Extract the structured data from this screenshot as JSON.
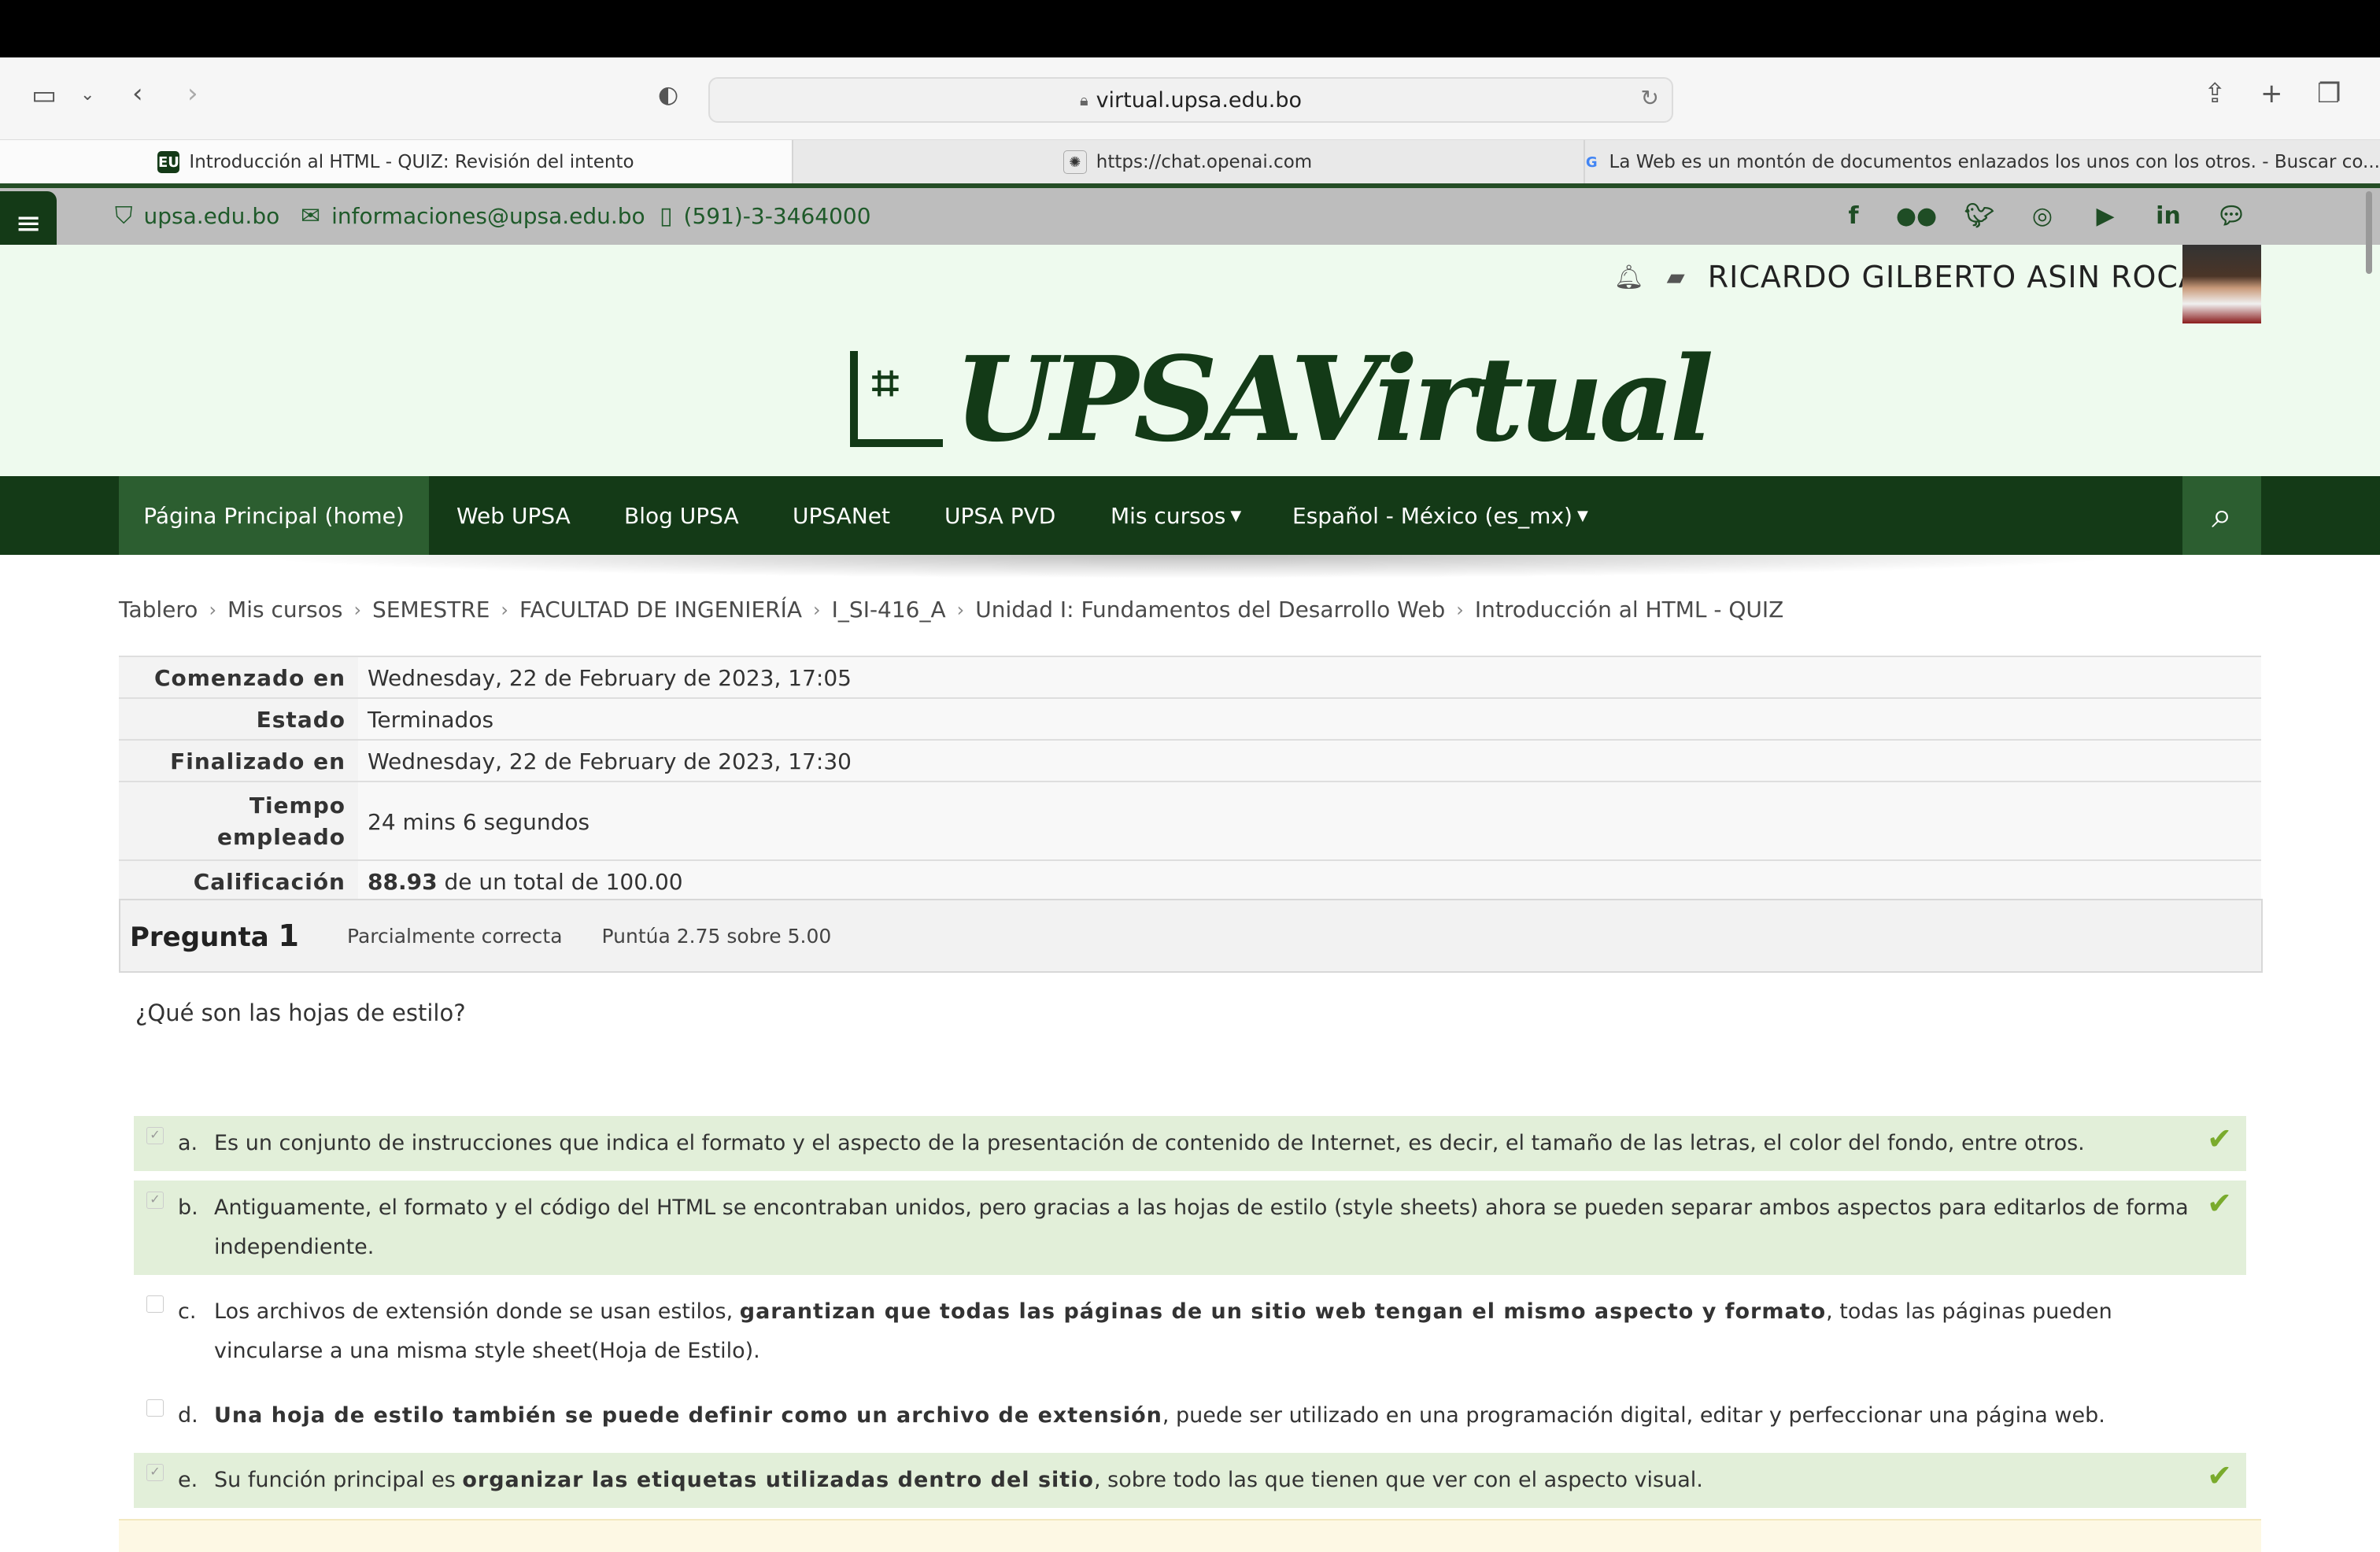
{
  "browser": {
    "url": "virtual.upsa.edu.bo",
    "tabs": [
      {
        "label": "Introducción al HTML - QUIZ: Revisión del intento",
        "fav": "EU"
      },
      {
        "label": "https://chat.openai.com",
        "fav": "✺"
      },
      {
        "label": "La Web es un montón de documentos enlazados los unos con los otros. - Buscar co...",
        "fav": "G"
      }
    ]
  },
  "contacts": {
    "website": "upsa.edu.bo",
    "email": "informaciones@upsa.edu.bo",
    "phone": "(591)-3-3464000"
  },
  "social_icons": [
    "facebook-icon",
    "flickr-icon",
    "twitter-icon",
    "instagram-icon",
    "youtube-icon",
    "linkedin-icon",
    "chat-icon"
  ],
  "user": {
    "name": "RICARDO GILBERTO ASIN ROCA"
  },
  "logo_text": "UPSAVirtual",
  "nav": [
    {
      "label": "Página Principal (home)"
    },
    {
      "label": "Web UPSA"
    },
    {
      "label": "Blog UPSA"
    },
    {
      "label": "UPSANet"
    },
    {
      "label": "UPSA PVD"
    },
    {
      "label": "Mis cursos"
    },
    {
      "label": "Español - México (es_mx)"
    }
  ],
  "breadcrumb": [
    "Tablero",
    "Mis cursos",
    "SEMESTRE",
    "FACULTAD DE INGENIERÍA",
    "I_SI-416_A",
    "Unidad I: Fundamentos del Desarrollo Web",
    "Introducción al HTML - QUIZ"
  ],
  "summary": [
    {
      "label": "Comenzado en",
      "value": "Wednesday, 22 de February de 2023, 17:05"
    },
    {
      "label": "Estado",
      "value": "Terminados"
    },
    {
      "label": "Finalizado en",
      "value": "Wednesday, 22 de February de 2023, 17:30"
    },
    {
      "label": "Tiempo empleado",
      "value": "24 mins 6 segundos"
    },
    {
      "label": "Calificación",
      "value_bold": "88.93",
      "value": " de un total de 100.00"
    }
  ],
  "question": {
    "prefix": "Pregunta",
    "number": "1",
    "state": "Parcialmente correcta",
    "grade": "Puntúa 2.75 sobre 5.00",
    "text": "¿Qué son las hojas de estilo?",
    "answers": [
      {
        "letter": "a.",
        "correct": true,
        "checked": true,
        "pre": "Es un conjunto de instrucciones que indica el formato y el aspecto de la presentación de contenido de Internet, es decir, el tamaño de las letras, el color del fondo, entre otros.",
        "bold": "",
        "post": ""
      },
      {
        "letter": "b.",
        "correct": true,
        "checked": true,
        "pre": "Antiguamente, el formato y el código del HTML se encontraban unidos, pero gracias a las hojas de estilo (style sheets) ahora se pueden separar ambos aspectos para editarlos de forma independiente.",
        "bold": "",
        "post": ""
      },
      {
        "letter": "c.",
        "correct": false,
        "checked": false,
        "pre": "Los archivos de extensión donde se usan estilos, ",
        "bold": "garantizan que todas las páginas de un sitio web tengan el mismo aspecto y formato",
        "post": ", todas las páginas pueden vincularse a una misma style sheet(Hoja de Estilo)."
      },
      {
        "letter": "d.",
        "correct": false,
        "checked": false,
        "pre": "",
        "bold": "Una hoja de estilo también se puede definir como un archivo de extensión",
        "post": ", puede ser utilizado en una programación digital, editar y perfeccionar una página web."
      },
      {
        "letter": "e.",
        "correct": true,
        "checked": true,
        "pre": "Su función principal es ",
        "bold": "organizar las etiquetas utilizadas dentro del sitio",
        "post": ", sobre todo las que tienen que ver con el aspecto visual."
      }
    ]
  }
}
